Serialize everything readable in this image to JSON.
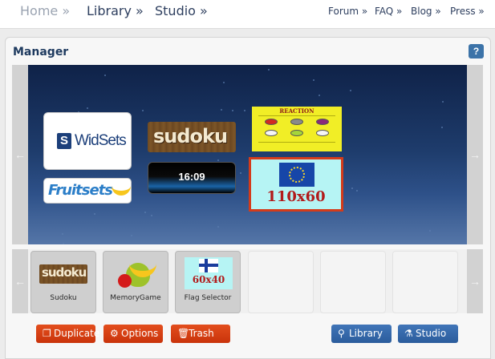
{
  "nav": {
    "home": "Home »",
    "library": "Library »",
    "studio": "Studio »",
    "forum": "Forum »",
    "faq": "FAQ »",
    "blog": "Blog »",
    "press": "Press »"
  },
  "manager": {
    "title": "Manager",
    "help_label": "?"
  },
  "stage": {
    "widgets": {
      "widsets_text": "WidSets",
      "widsets_logo": "S",
      "fruitsets_text": "Fruitsets",
      "sudoku_text": "sudoku",
      "clock_text": "16:09",
      "reaction_text": "REACTION",
      "flag_text": "110x60"
    },
    "left_arrow": "←",
    "right_arrow": "→"
  },
  "strip": {
    "left_arrow": "←",
    "right_arrow": "→",
    "items": [
      {
        "label": "Sudoku",
        "image_text": "sudoku"
      },
      {
        "label": "MemoryGame"
      },
      {
        "label": "Flag Selector",
        "image_text": "60x40"
      }
    ]
  },
  "actions": {
    "duplicate": "Duplicate",
    "options": "Options",
    "trash": "Trash",
    "library": "Library",
    "studio": "Studio"
  },
  "icons": {
    "duplicate": "duplicate-icon",
    "options": "wrench-icon",
    "trash": "trash-icon",
    "library": "search-icon",
    "studio": "flask-icon"
  },
  "colors": {
    "nav_text": "#2e3f5f",
    "nav_home": "#9aa3b1",
    "panel_title": "#1e3a5f",
    "stage_top": "#0f2248",
    "stage_bottom": "#5576a8",
    "red_button": "#d63e12",
    "blue_button": "#3366a8",
    "selected_border": "#d43b1a"
  }
}
